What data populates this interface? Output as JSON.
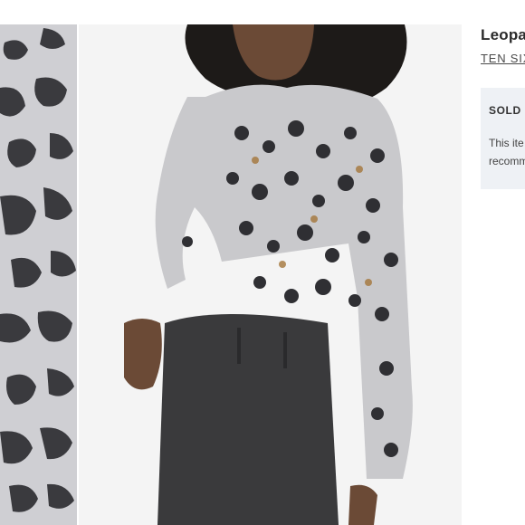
{
  "product": {
    "title": "Leopa",
    "brand": "TEN SIX",
    "availability": {
      "status": "SOLD C",
      "message_line1": "This ite",
      "message_line2": "recomm"
    }
  },
  "gallery": {
    "thumbnail_icon": "fabric-detail-image",
    "main_image_icon": "model-wearing-product-image"
  },
  "colors": {
    "thumb_bg": "#c9c9cc",
    "info_panel": "#eef1f5",
    "jeans": "#3a3a3c"
  }
}
